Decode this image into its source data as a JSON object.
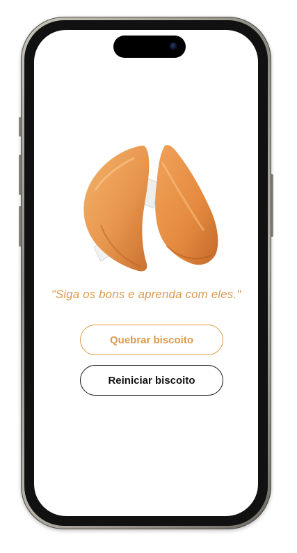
{
  "app": {
    "phrase": "\"Siga os bons e aprenda com eles.\"",
    "buttons": {
      "break_label": "Quebrar biscoito",
      "reset_label": "Reiniciar biscoito"
    },
    "colors": {
      "accent": "#dd9a4c",
      "text_dark": "#111111",
      "background": "#ffffff"
    },
    "image": {
      "icon": "fortune-cookie-broken"
    }
  }
}
